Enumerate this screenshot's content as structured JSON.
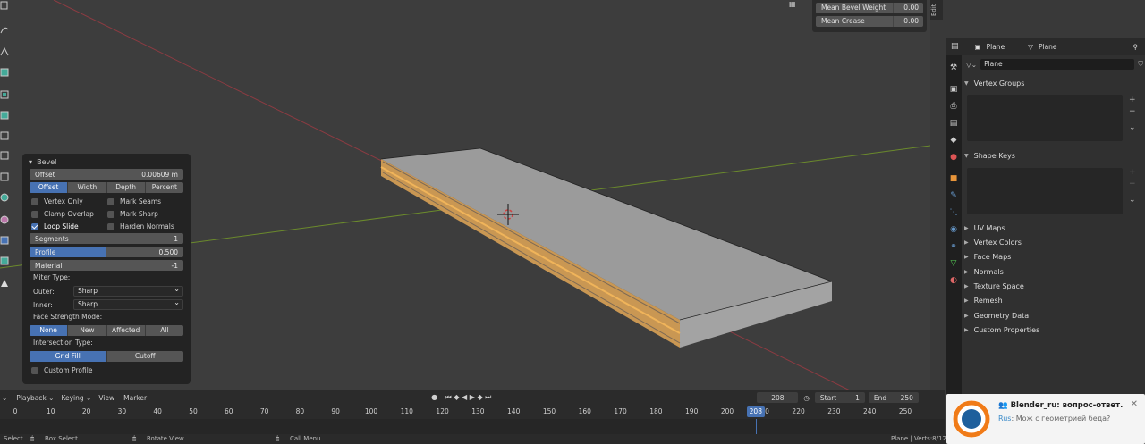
{
  "overlay": {
    "mean_bevel_weight_label": "Mean Bevel Weight",
    "mean_bevel_weight_value": "0.00",
    "mean_crease_label": "Mean Crease",
    "mean_crease_value": "0.00",
    "edit_tab": "Edit"
  },
  "bevel": {
    "title": "Bevel",
    "offset_label": "Offset",
    "offset_value": "0.00609 m",
    "width_type": [
      "Offset",
      "Width",
      "Depth",
      "Percent"
    ],
    "width_type_selected": 0,
    "vertex_only": "Vertex Only",
    "mark_seams": "Mark Seams",
    "clamp_overlap": "Clamp Overlap",
    "mark_sharp": "Mark Sharp",
    "loop_slide": "Loop Slide",
    "loop_slide_checked": true,
    "harden_normals": "Harden Normals",
    "segments_label": "Segments",
    "segments_value": "1",
    "profile_label": "Profile",
    "profile_value": "0.500",
    "profile_fraction": 0.5,
    "material_label": "Material",
    "material_value": "-1",
    "miter_type_label": "Miter Type:",
    "outer_label": "Outer:",
    "outer_value": "Sharp",
    "inner_label": "Inner:",
    "inner_value": "Sharp",
    "face_strength_label": "Face Strength Mode:",
    "face_strength": [
      "None",
      "New",
      "Affected",
      "All"
    ],
    "face_strength_selected": 0,
    "intersection_label": "Intersection Type:",
    "intersection": [
      "Grid Fill",
      "Cutoff"
    ],
    "intersection_selected": 0,
    "custom_profile": "Custom Profile"
  },
  "properties": {
    "header_object": "Plane",
    "header_mesh": "Plane",
    "mesh_name": "Plane",
    "vertex_groups": "Vertex Groups",
    "shape_keys": "Shape Keys",
    "collapsed_panels": [
      "UV Maps",
      "Vertex Colors",
      "Face Maps",
      "Normals",
      "Texture Space",
      "Remesh",
      "Geometry Data",
      "Custom Properties"
    ]
  },
  "timeline": {
    "playback": "Playback",
    "keying": "Keying",
    "view": "View",
    "marker": "Marker",
    "current_frame": "208",
    "start_label": "Start",
    "start_value": "1",
    "end_label": "End",
    "end_value": "250",
    "ticks": [
      "0",
      "10",
      "20",
      "30",
      "40",
      "50",
      "60",
      "70",
      "80",
      "90",
      "100",
      "110",
      "120",
      "130",
      "140",
      "150",
      "160",
      "170",
      "180",
      "190",
      "200",
      "210",
      "220",
      "230",
      "240",
      "250"
    ],
    "playhead_label": "208"
  },
  "status": {
    "select": "Select",
    "box_select": "Box Select",
    "rotate_view": "Rotate View",
    "call_menu": "Call Menu",
    "stats": "Plane | Verts:8/12"
  },
  "notification": {
    "title": "Blender_ru: вопрос-ответ.",
    "sender": "Rus",
    "message": "Мож с геометрией беда?"
  },
  "colors": {
    "accent": "#4772b3",
    "selection_orange": "#e8a544",
    "mesh_gray": "#9a9a9a"
  }
}
